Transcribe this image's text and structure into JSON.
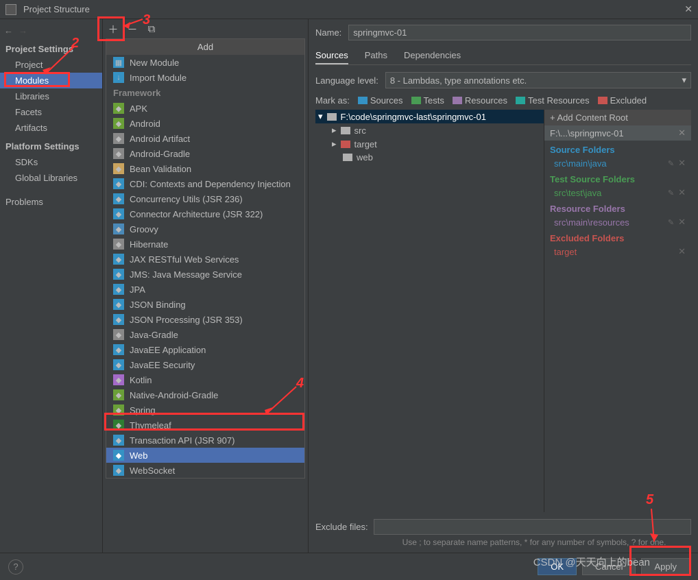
{
  "window": {
    "title": "Project Structure"
  },
  "nav": {
    "sections": {
      "project": "Project Settings",
      "platform": "Platform Settings"
    },
    "project_items": [
      "Project",
      "Modules",
      "Libraries",
      "Facets",
      "Artifacts"
    ],
    "platform_items": [
      "SDKs",
      "Global Libraries"
    ],
    "problems": "Problems"
  },
  "popup": {
    "title": "Add",
    "top_items": [
      "New Module",
      "Import Module"
    ],
    "group": "Framework",
    "frameworks": [
      "APK",
      "Android",
      "Android Artifact",
      "Android-Gradle",
      "Bean Validation",
      "CDI: Contexts and Dependency Injection",
      "Concurrency Utils (JSR 236)",
      "Connector Architecture (JSR 322)",
      "Groovy",
      "Hibernate",
      "JAX RESTful Web Services",
      "JMS: Java Message Service",
      "JPA",
      "JSON Binding",
      "JSON Processing (JSR 353)",
      "Java-Gradle",
      "JavaEE Application",
      "JavaEE Security",
      "Kotlin",
      "Native-Android-Gradle",
      "Spring",
      "Thymeleaf",
      "Transaction API (JSR 907)",
      "Web",
      "WebSocket"
    ],
    "selected": "Web"
  },
  "right": {
    "name_label": "Name:",
    "name_value": "springmvc-01",
    "tabs": [
      "Sources",
      "Paths",
      "Dependencies"
    ],
    "lang_label": "Language level:",
    "lang_value": "8 - Lambdas, type annotations etc.",
    "markas_label": "Mark as:",
    "markas": [
      "Sources",
      "Tests",
      "Resources",
      "Test Resources",
      "Excluded"
    ],
    "tree_root": "F:\\code\\springmvc-last\\springmvc-01",
    "tree_children": [
      "src",
      "target",
      "web"
    ],
    "add_root": "+ Add Content Root",
    "root_path": "F:\\...\\springmvc-01",
    "source_folders_h": "Source Folders",
    "source_folders": [
      "src\\main\\java"
    ],
    "test_folders_h": "Test Source Folders",
    "test_folders": [
      "src\\test\\java"
    ],
    "resource_folders_h": "Resource Folders",
    "resource_folders": [
      "src\\main\\resources"
    ],
    "excluded_folders_h": "Excluded Folders",
    "excluded_folders": [
      "target"
    ],
    "exclude_label": "Exclude files:",
    "exclude_hint": "Use ; to separate name patterns, * for any number of symbols, ? for one."
  },
  "footer": {
    "ok": "OK",
    "cancel": "Cancel",
    "apply": "Apply"
  },
  "annotations": {
    "n2": "2",
    "n3": "3",
    "n4": "4",
    "n5": "5"
  },
  "watermark": "CSDN @天天向上的bean"
}
